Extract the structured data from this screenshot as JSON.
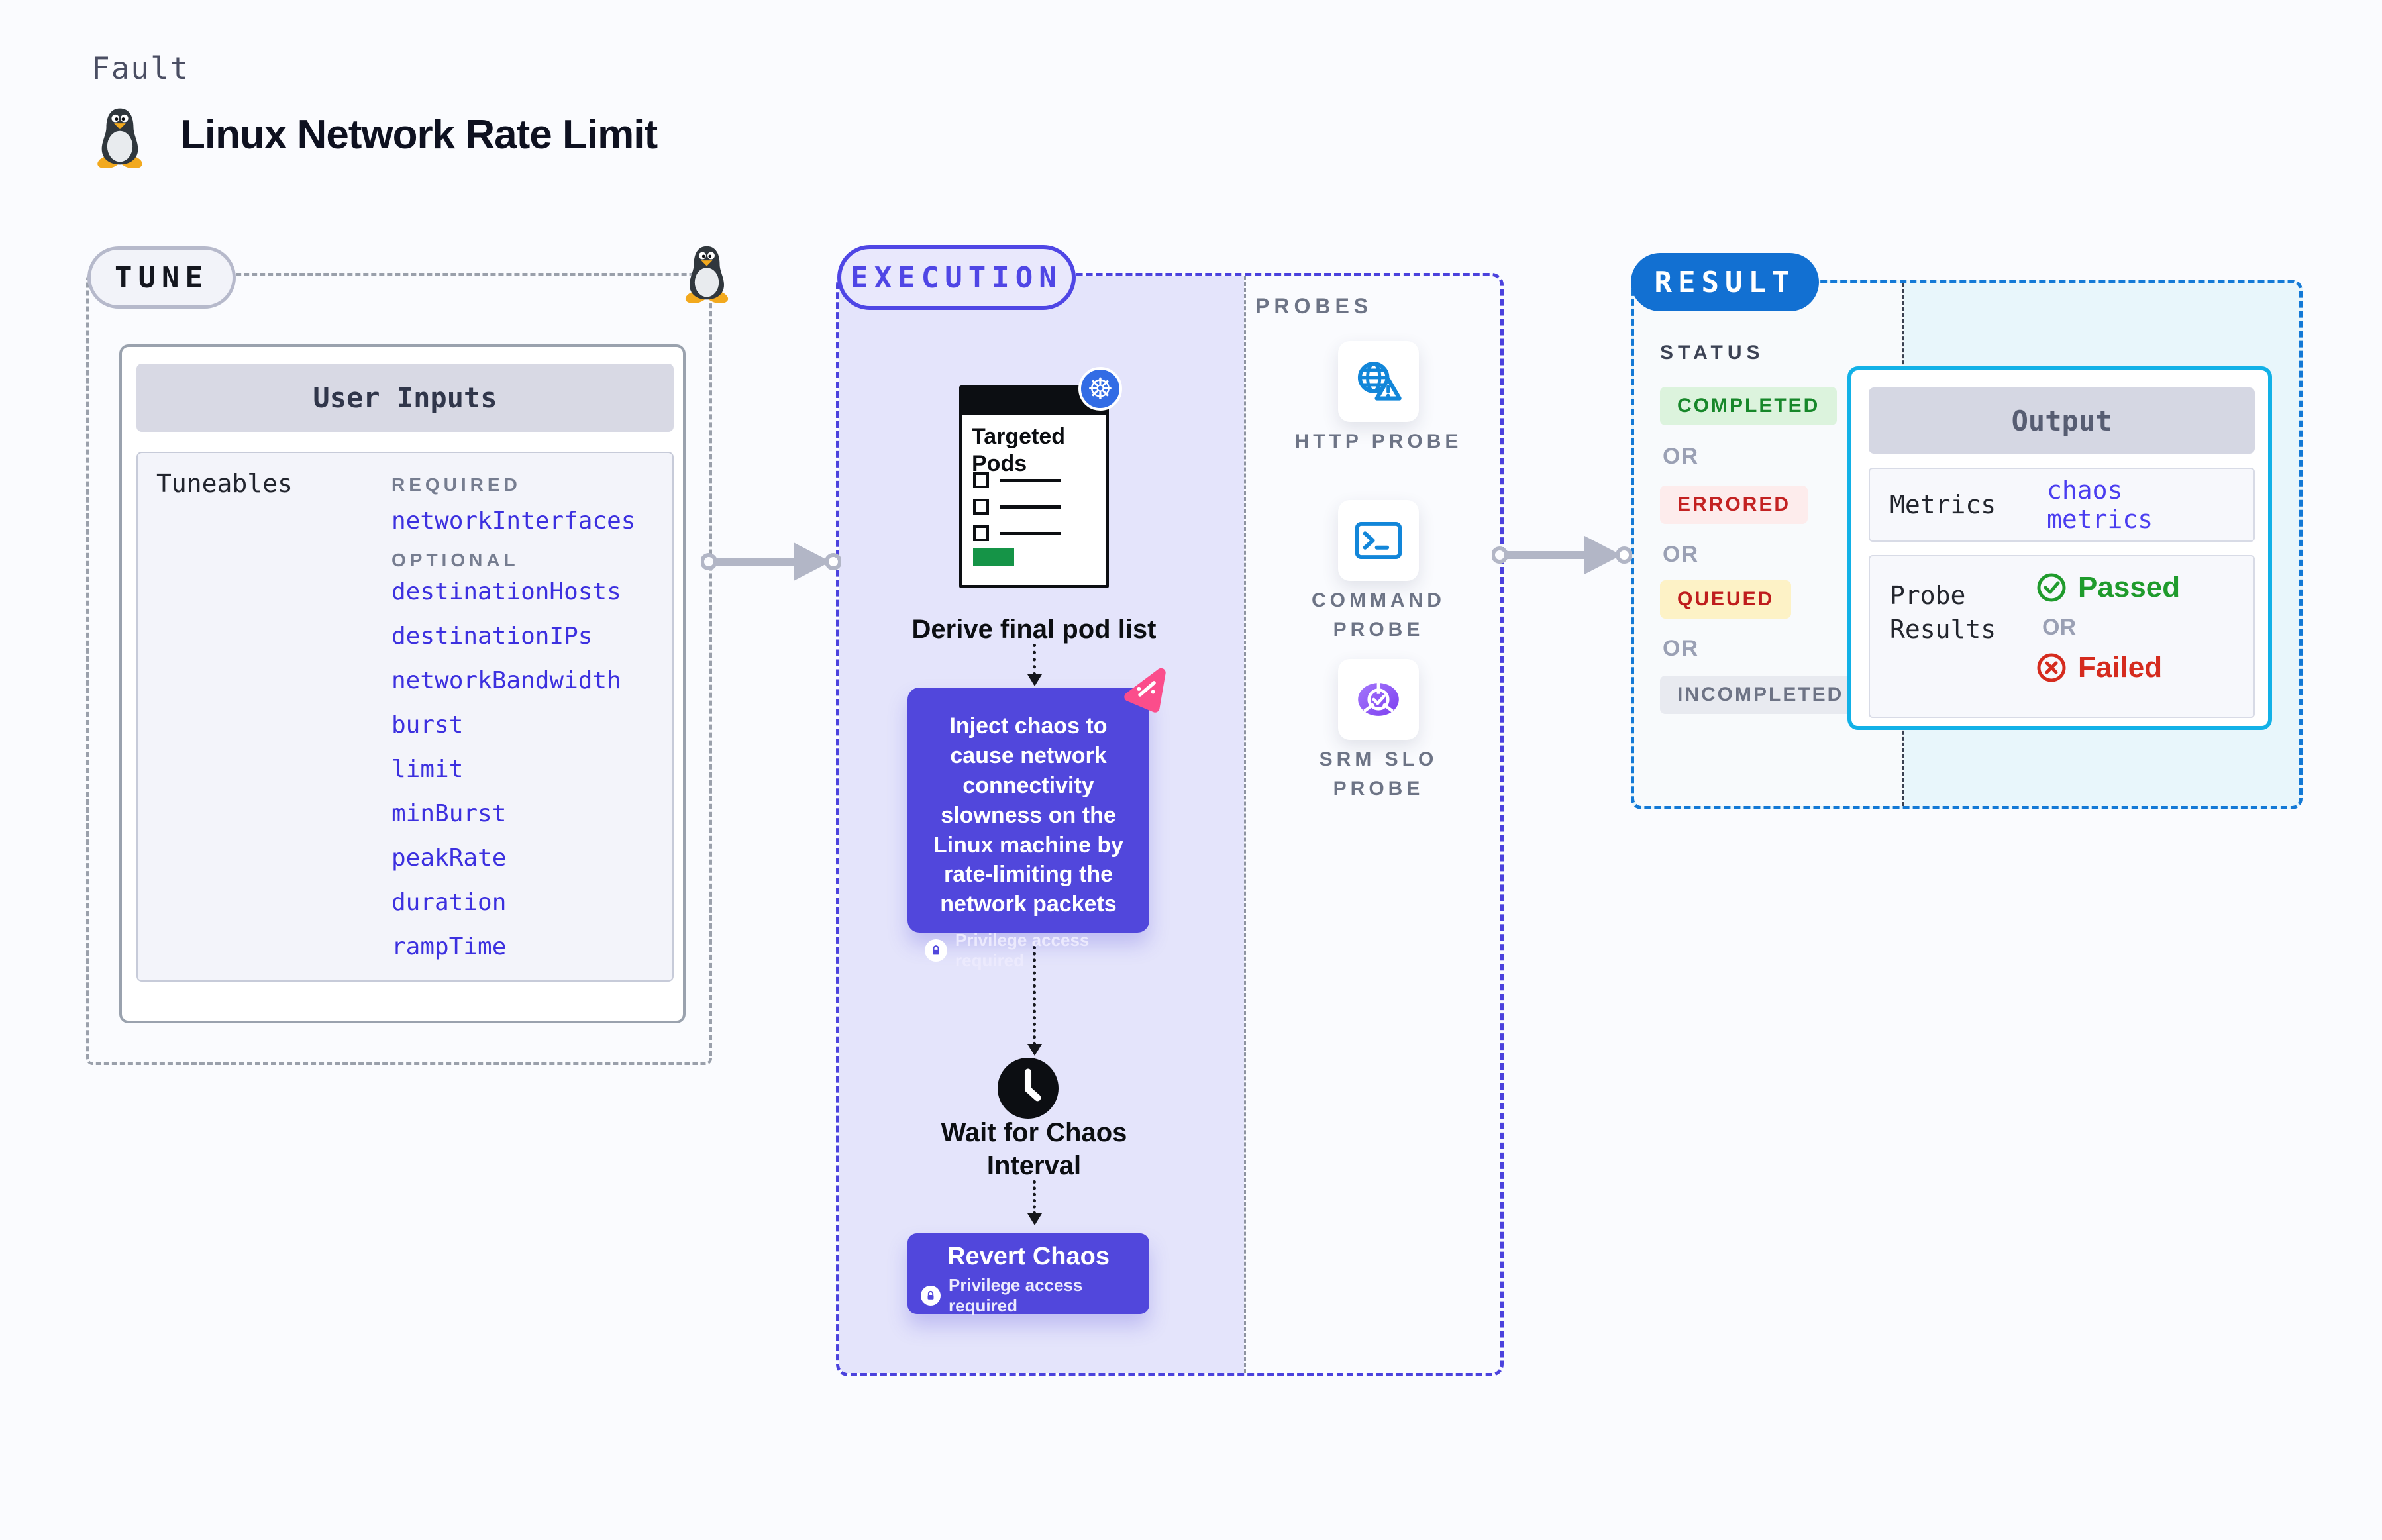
{
  "page": {
    "fault_label": "Fault",
    "title": "Linux Network Rate Limit"
  },
  "tune": {
    "label": "TUNE",
    "card_title": "User Inputs",
    "tuneables_label": "Tuneables",
    "required_label": "REQUIRED",
    "optional_label": "OPTIONAL",
    "required_items": [
      "networkInterfaces"
    ],
    "optional_items": [
      "destinationHosts",
      "destinationIPs",
      "networkBandwidth",
      "burst",
      "limit",
      "minBurst",
      "peakRate",
      "duration",
      "rampTime"
    ]
  },
  "execution": {
    "label": "EXECUTION",
    "pods_title": "Targeted Pods",
    "derive_label": "Derive final pod list",
    "inject_text": "Inject chaos to cause network connectivity slowness on the Linux machine by rate-limiting the network packets",
    "privilege_label": "Privilege access required",
    "wait_label": "Wait for Chaos Interval",
    "revert_label": "Revert Chaos"
  },
  "probes": {
    "label": "PROBES",
    "items": [
      {
        "label": "HTTP PROBE",
        "icon": "globe-alert-icon"
      },
      {
        "label": "COMMAND PROBE",
        "icon": "terminal-icon"
      },
      {
        "label": "SRM SLO PROBE",
        "icon": "slo-gauge-icon"
      }
    ]
  },
  "result": {
    "label": "RESULT",
    "status_label": "STATUS",
    "or_label": "OR",
    "statuses": [
      {
        "label": "COMPLETED",
        "fg": "#17872a",
        "bg": "#dcf3dd"
      },
      {
        "label": "ERRORED",
        "fg": "#c32222",
        "bg": "#fdecec"
      },
      {
        "label": "QUEUED",
        "fg": "#bf1d1d",
        "bg": "#fdf2c6"
      },
      {
        "label": "INCOMPLETED",
        "fg": "#6d7385",
        "bg": "#e8eaf0"
      }
    ],
    "output": {
      "title": "Output",
      "metrics_label": "Metrics",
      "metrics_value": "chaos metrics",
      "probe_results_label": "Probe Results",
      "passed_label": "Passed",
      "failed_label": "Failed"
    }
  },
  "icons": {
    "tux-icon": "linux penguin",
    "kubernetes-icon": "☸",
    "clock-icon": "clock",
    "lock-icon": "padlock",
    "chaos-icon": "pink chaos triangle",
    "globe-alert-icon": "globe with warning triangle",
    "terminal-icon": "command terminal",
    "slo-gauge-icon": "purple slo gauge with check",
    "check-circle-icon": "green circled check",
    "x-circle-icon": "red circled x",
    "arrow-right-icon": "gray connector arrow"
  },
  "colors": {
    "canvas": "#fafbfe",
    "accent_indigo": "#4f46e5",
    "execution_fill": "#e4e4fb",
    "node_indigo": "#5147dc",
    "result_blue": "#1270d2",
    "output_cyan": "#12b1e7",
    "link_indigo": "#3c30df",
    "passed_green": "#1f9b2c",
    "failed_red": "#d52b1e",
    "k8s_blue": "#326ce5",
    "chaos_pink": "#fb4d8b",
    "tux_yellow": "#f2a91e"
  }
}
